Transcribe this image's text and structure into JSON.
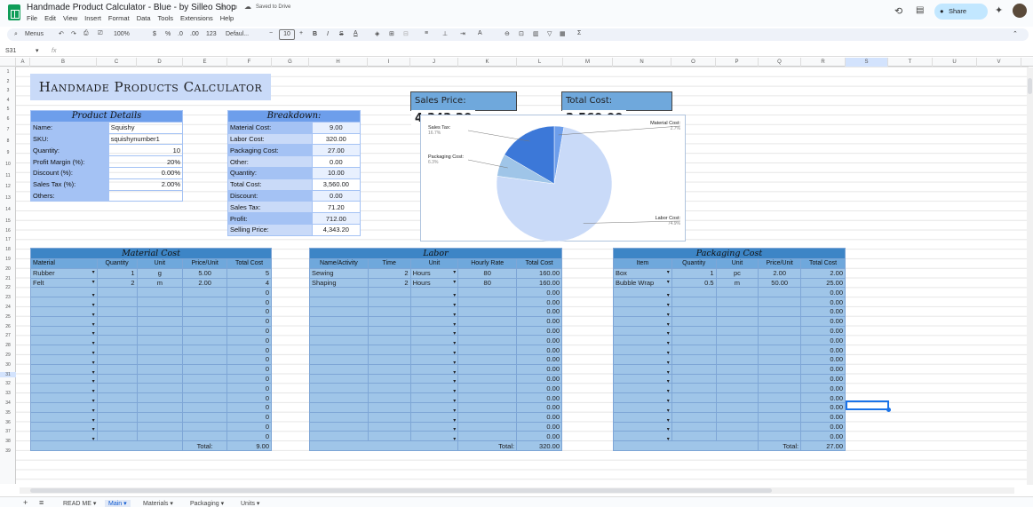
{
  "app": {
    "doc_title": "Handmade Product Calculator - Blue - by Silleo Shop",
    "saved_status": "Saved to Drive",
    "menu": [
      "File",
      "Edit",
      "View",
      "Insert",
      "Format",
      "Data",
      "Tools",
      "Extensions",
      "Help"
    ],
    "share_label": "Share"
  },
  "toolbar": {
    "menus_label": "Menus",
    "zoom": "100%",
    "currency": "$",
    "percent": "%",
    "dec_less": ".0",
    "dec_more": ".00",
    "number_fmt": "123",
    "font": "Defaul...",
    "font_size": "10"
  },
  "formula_bar": {
    "cell_ref": "S31",
    "fx": "fx"
  },
  "columns": [
    "A",
    "B",
    "C",
    "D",
    "E",
    "F",
    "G",
    "H",
    "I",
    "J",
    "K",
    "L",
    "M",
    "N",
    "O",
    "P",
    "Q",
    "R",
    "S",
    "T",
    "U",
    "V"
  ],
  "rows": [
    "1",
    "2",
    "3",
    "4",
    "5",
    "6",
    "7",
    "8",
    "9",
    "10",
    "11",
    "12",
    "13",
    "14",
    "15",
    "16",
    "17",
    "18",
    "19",
    "20",
    "21",
    "22",
    "23",
    "24",
    "25",
    "26",
    "27",
    "28",
    "29",
    "30",
    "31",
    "32",
    "33",
    "34",
    "35",
    "36",
    "37",
    "38",
    "39"
  ],
  "banner": "Handmade Products Calculator",
  "sales_price": {
    "label": "Sales Price:",
    "value": "4,343.20"
  },
  "total_cost": {
    "label": "Total Cost:",
    "value": "3,560.00"
  },
  "product_details": {
    "title": "Product Details",
    "rows": [
      {
        "label": "Name:",
        "value": "Squishy"
      },
      {
        "label": "SKU:",
        "value": "squishynumber1"
      },
      {
        "label": "Quantity:",
        "value": "10"
      },
      {
        "label": "Profit Margin (%):",
        "value": "20%"
      },
      {
        "label": "Discount (%):",
        "value": "0.00%"
      },
      {
        "label": "Sales Tax (%):",
        "value": "2.00%"
      },
      {
        "label": "Others:",
        "value": ""
      }
    ]
  },
  "breakdown": {
    "title": "Breakdown:",
    "rows": [
      {
        "label": "Material Cost:",
        "value": "9.00"
      },
      {
        "label": "Labor Cost:",
        "value": "320.00"
      },
      {
        "label": "Packaging Cost:",
        "value": "27.00"
      },
      {
        "label": "Other:",
        "value": "0.00"
      },
      {
        "label": "Quantity:",
        "value": "10.00"
      },
      {
        "label": "Total Cost:",
        "value": "3,560.00"
      },
      {
        "label": "Discount:",
        "value": "0.00"
      },
      {
        "label": "Sales Tax:",
        "value": "71.20"
      },
      {
        "label": "Profit:",
        "value": "712.00"
      },
      {
        "label": "Selling Price:",
        "value": "4,343.20"
      }
    ]
  },
  "chart_data": {
    "type": "pie",
    "slices": [
      {
        "name": "Material Cost",
        "pct": "2.7%",
        "value": 2.7,
        "color": "#6d9eeb"
      },
      {
        "name": "Labor Cost",
        "pct": "74.9%",
        "value": 74.9,
        "color": "#c9daf8"
      },
      {
        "name": "Packaging Cost",
        "pct": "6.3%",
        "value": 6.3,
        "color": "#9fc5e8"
      },
      {
        "name": "Sales Tax",
        "pct": "16.7%",
        "value": 16.7,
        "color": "#3c78d8"
      }
    ]
  },
  "material_cost": {
    "title": "Material Cost",
    "headers": [
      "Material",
      "Quantity",
      "Unit",
      "Price/Unit",
      "Total Cost"
    ],
    "rows": [
      [
        "Rubber",
        "1",
        "g",
        "5.00",
        "5"
      ],
      [
        "Felt",
        "2",
        "m",
        "2.00",
        "4"
      ],
      [
        "",
        "",
        "",
        "",
        "0"
      ],
      [
        "",
        "",
        "",
        "",
        "0"
      ],
      [
        "",
        "",
        "",
        "",
        "0"
      ],
      [
        "",
        "",
        "",
        "",
        "0"
      ],
      [
        "",
        "",
        "",
        "",
        "0"
      ],
      [
        "",
        "",
        "",
        "",
        "0"
      ],
      [
        "",
        "",
        "",
        "",
        "0"
      ],
      [
        "",
        "",
        "",
        "",
        "0"
      ],
      [
        "",
        "",
        "",
        "",
        "0"
      ],
      [
        "",
        "",
        "",
        "",
        "0"
      ],
      [
        "",
        "",
        "",
        "",
        "0"
      ],
      [
        "",
        "",
        "",
        "",
        "0"
      ],
      [
        "",
        "",
        "",
        "",
        "0"
      ],
      [
        "",
        "",
        "",
        "",
        "0"
      ],
      [
        "",
        "",
        "",
        "",
        "0"
      ],
      [
        "",
        "",
        "",
        "",
        "0"
      ]
    ],
    "total_label": "Total:",
    "total": "9.00"
  },
  "labor": {
    "title": "Labor",
    "headers": [
      "Name/Activity",
      "Time",
      "Unit",
      "Hourly Rate",
      "Total Cost"
    ],
    "rows": [
      [
        "Sewing",
        "2",
        "Hours",
        "80",
        "160.00"
      ],
      [
        "Shaping",
        "2",
        "Hours",
        "80",
        "160.00"
      ],
      [
        "",
        "",
        "",
        "",
        "0.00"
      ],
      [
        "",
        "",
        "",
        "",
        "0.00"
      ],
      [
        "",
        "",
        "",
        "",
        "0.00"
      ],
      [
        "",
        "",
        "",
        "",
        "0.00"
      ],
      [
        "",
        "",
        "",
        "",
        "0.00"
      ],
      [
        "",
        "",
        "",
        "",
        "0.00"
      ],
      [
        "",
        "",
        "",
        "",
        "0.00"
      ],
      [
        "",
        "",
        "",
        "",
        "0.00"
      ],
      [
        "",
        "",
        "",
        "",
        "0.00"
      ],
      [
        "",
        "",
        "",
        "",
        "0.00"
      ],
      [
        "",
        "",
        "",
        "",
        "0.00"
      ],
      [
        "",
        "",
        "",
        "",
        "0.00"
      ],
      [
        "",
        "",
        "",
        "",
        "0.00"
      ],
      [
        "",
        "",
        "",
        "",
        "0.00"
      ],
      [
        "",
        "",
        "",
        "",
        "0.00"
      ],
      [
        "",
        "",
        "",
        "",
        "0.00"
      ]
    ],
    "total_label": "Total:",
    "total": "320.00"
  },
  "packaging": {
    "title": "Packaging Cost",
    "headers": [
      "Item",
      "Quantity",
      "Unit",
      "Price/Unit",
      "Total Cost"
    ],
    "rows": [
      [
        "Box",
        "1",
        "pc",
        "2.00",
        "2.00"
      ],
      [
        "Bubble Wrap",
        "0.5",
        "m",
        "50.00",
        "25.00"
      ],
      [
        "",
        "",
        "",
        "",
        "0.00"
      ],
      [
        "",
        "",
        "",
        "",
        "0.00"
      ],
      [
        "",
        "",
        "",
        "",
        "0.00"
      ],
      [
        "",
        "",
        "",
        "",
        "0.00"
      ],
      [
        "",
        "",
        "",
        "",
        "0.00"
      ],
      [
        "",
        "",
        "",
        "",
        "0.00"
      ],
      [
        "",
        "",
        "",
        "",
        "0.00"
      ],
      [
        "",
        "",
        "",
        "",
        "0.00"
      ],
      [
        "",
        "",
        "",
        "",
        "0.00"
      ],
      [
        "",
        "",
        "",
        "",
        "0.00"
      ],
      [
        "",
        "",
        "",
        "",
        "0.00"
      ],
      [
        "",
        "",
        "",
        "",
        "0.00"
      ],
      [
        "",
        "",
        "",
        "",
        "0.00"
      ],
      [
        "",
        "",
        "",
        "",
        "0.00"
      ],
      [
        "",
        "",
        "",
        "",
        "0.00"
      ],
      [
        "",
        "",
        "",
        "",
        "0.00"
      ]
    ],
    "total_label": "Total:",
    "total": "27.00"
  },
  "sheet_tabs": [
    "READ ME",
    "Main",
    "Materials",
    "Packaging",
    "Units"
  ]
}
